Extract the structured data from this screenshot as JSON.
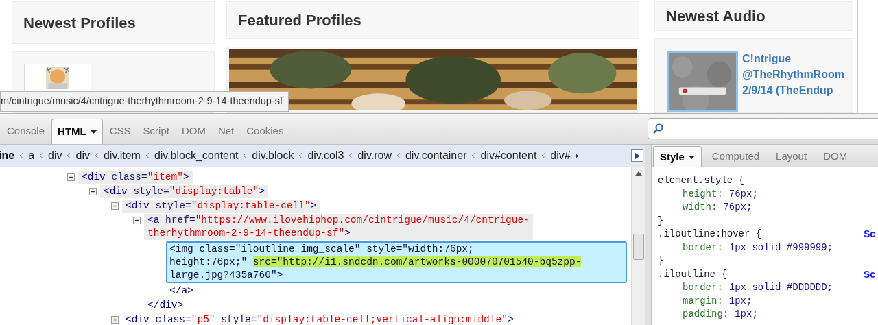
{
  "page": {
    "columns": [
      {
        "title": "Newest Profiles"
      },
      {
        "title": "Featured Profiles"
      },
      {
        "title": "Newest Audio",
        "item_lines": [
          "C!ntrigue",
          "@TheRhythmRoom",
          "2/9/14 (TheEndup"
        ]
      }
    ]
  },
  "status_url": "m/cintrigue/music/4/cntrigue-therhythmroom-2-9-14-theendup-sf",
  "devtools": {
    "tabs": [
      {
        "label": "Console",
        "selected": false
      },
      {
        "label": "HTML",
        "selected": true
      },
      {
        "label": "CSS",
        "selected": false
      },
      {
        "label": "Script",
        "selected": false
      },
      {
        "label": "DOM",
        "selected": false
      },
      {
        "label": "Net",
        "selected": false
      },
      {
        "label": "Cookies",
        "selected": false
      }
    ],
    "breadcrumbs": [
      {
        "label": "ine",
        "selected": true
      },
      {
        "label": "a",
        "selected": false
      },
      {
        "label": "div",
        "selected": false
      },
      {
        "label": "div",
        "selected": false
      },
      {
        "label": "div.item",
        "selected": false
      },
      {
        "label": "div.block_content",
        "selected": false
      },
      {
        "label": "div.block",
        "selected": false
      },
      {
        "label": "div.col3",
        "selected": false
      },
      {
        "label": "div.row",
        "selected": false
      },
      {
        "label": "div.container",
        "selected": false
      },
      {
        "label": "div#content",
        "selected": false
      },
      {
        "label": "div#",
        "selected": false
      }
    ],
    "side_tabs": [
      {
        "label": "Style",
        "selected": true
      },
      {
        "label": "Computed",
        "selected": false
      },
      {
        "label": "Layout",
        "selected": false
      },
      {
        "label": "DOM",
        "selected": false
      }
    ],
    "tree": [
      {
        "expanded": true,
        "ancestor": true,
        "selected": false,
        "lines": [
          [
            {
              "kind": "tag",
              "text": "<div"
            },
            {
              "kind": "attr",
              "text": " class="
            },
            {
              "kind": "value",
              "text": "\"item\""
            },
            {
              "kind": "tag",
              "text": ">"
            }
          ]
        ],
        "children": [
          {
            "expanded": true,
            "ancestor": true,
            "selected": false,
            "lines": [
              [
                {
                  "kind": "tag",
                  "text": "<div"
                },
                {
                  "kind": "attr",
                  "text": " style="
                },
                {
                  "kind": "value",
                  "text": "\"display:table\""
                },
                {
                  "kind": "tag",
                  "text": ">"
                }
              ]
            ],
            "children": [
              {
                "expanded": true,
                "ancestor": true,
                "selected": false,
                "lines": [
                  [
                    {
                      "kind": "tag",
                      "text": "<div"
                    },
                    {
                      "kind": "attr",
                      "text": " style="
                    },
                    {
                      "kind": "value",
                      "text": "\"display:table-cell\""
                    },
                    {
                      "kind": "tag",
                      "text": ">"
                    }
                  ]
                ],
                "children": [
                  {
                    "expanded": true,
                    "ancestor": true,
                    "selected": false,
                    "lines": [
                      [
                        {
                          "kind": "tag",
                          "text": "<a"
                        },
                        {
                          "kind": "attr",
                          "text": " href="
                        },
                        {
                          "kind": "value",
                          "text": "\"https://www.ilovehiphop.com/cintrigue/music/4/cntrigue-"
                        }
                      ],
                      [
                        {
                          "kind": "value",
                          "text": "therhythmroom-2-9-14-theendup-sf\""
                        },
                        {
                          "kind": "tag",
                          "text": ">"
                        }
                      ]
                    ],
                    "children": [
                      {
                        "selected": true,
                        "lines": [
                          [
                            {
                              "kind": "plain",
                              "text": "<img class=\"iloutline img_scale\" style=\"width:76px;"
                            }
                          ],
                          [
                            {
                              "kind": "plain",
                              "text": "height:76px;\" "
                            },
                            {
                              "kind": "changed",
                              "text": "src=\"http://i1.sndcdn.com/artworks-000070701540-bq5zpp-"
                            }
                          ],
                          [
                            {
                              "kind": "plain",
                              "text": "large.jpg?435a760\">"
                            }
                          ]
                        ]
                      },
                      {
                        "ancestor": false,
                        "selected": false,
                        "lines": [
                          [
                            {
                              "kind": "tag",
                              "text": "</a>"
                            }
                          ]
                        ]
                      }
                    ]
                  },
                  {
                    "ancestor": false,
                    "selected": false,
                    "lines": [
                      [
                        {
                          "kind": "tag",
                          "text": "</div>"
                        }
                      ]
                    ]
                  }
                ]
              },
              {
                "expanded": false,
                "ancestor": false,
                "selected": false,
                "lines": [
                  [
                    {
                      "kind": "tag",
                      "text": "<div"
                    },
                    {
                      "kind": "attr",
                      "text": " class="
                    },
                    {
                      "kind": "value",
                      "text": "\"p5\""
                    },
                    {
                      "kind": "attr",
                      "text": " style="
                    },
                    {
                      "kind": "value",
                      "text": "\"display:table-cell;vertical-align:middle\""
                    },
                    {
                      "kind": "tag",
                      "text": ">"
                    }
                  ]
                ]
              }
            ]
          }
        ]
      }
    ],
    "rules": [
      {
        "selector": "element.style {",
        "properties": [
          {
            "name": "height:",
            "value": "76px;",
            "overridden": false
          },
          {
            "name": "width:",
            "value": "76px;",
            "overridden": false
          }
        ],
        "close": "}"
      },
      {
        "selector": ".iloutline:hover {",
        "source": "Sc",
        "properties": [
          {
            "name": "border:",
            "value": "1px solid #999999;",
            "overridden": false
          }
        ],
        "close": "}"
      },
      {
        "selector": ".iloutline {",
        "source": "Sc",
        "properties": [
          {
            "name": "border:",
            "value": "1px solid #DDDDDD;",
            "overridden": true
          },
          {
            "name": "margin:",
            "value": "1px;",
            "overridden": false
          },
          {
            "name": "padding:",
            "value": "1px;",
            "overridden": false
          }
        ]
      }
    ]
  }
}
